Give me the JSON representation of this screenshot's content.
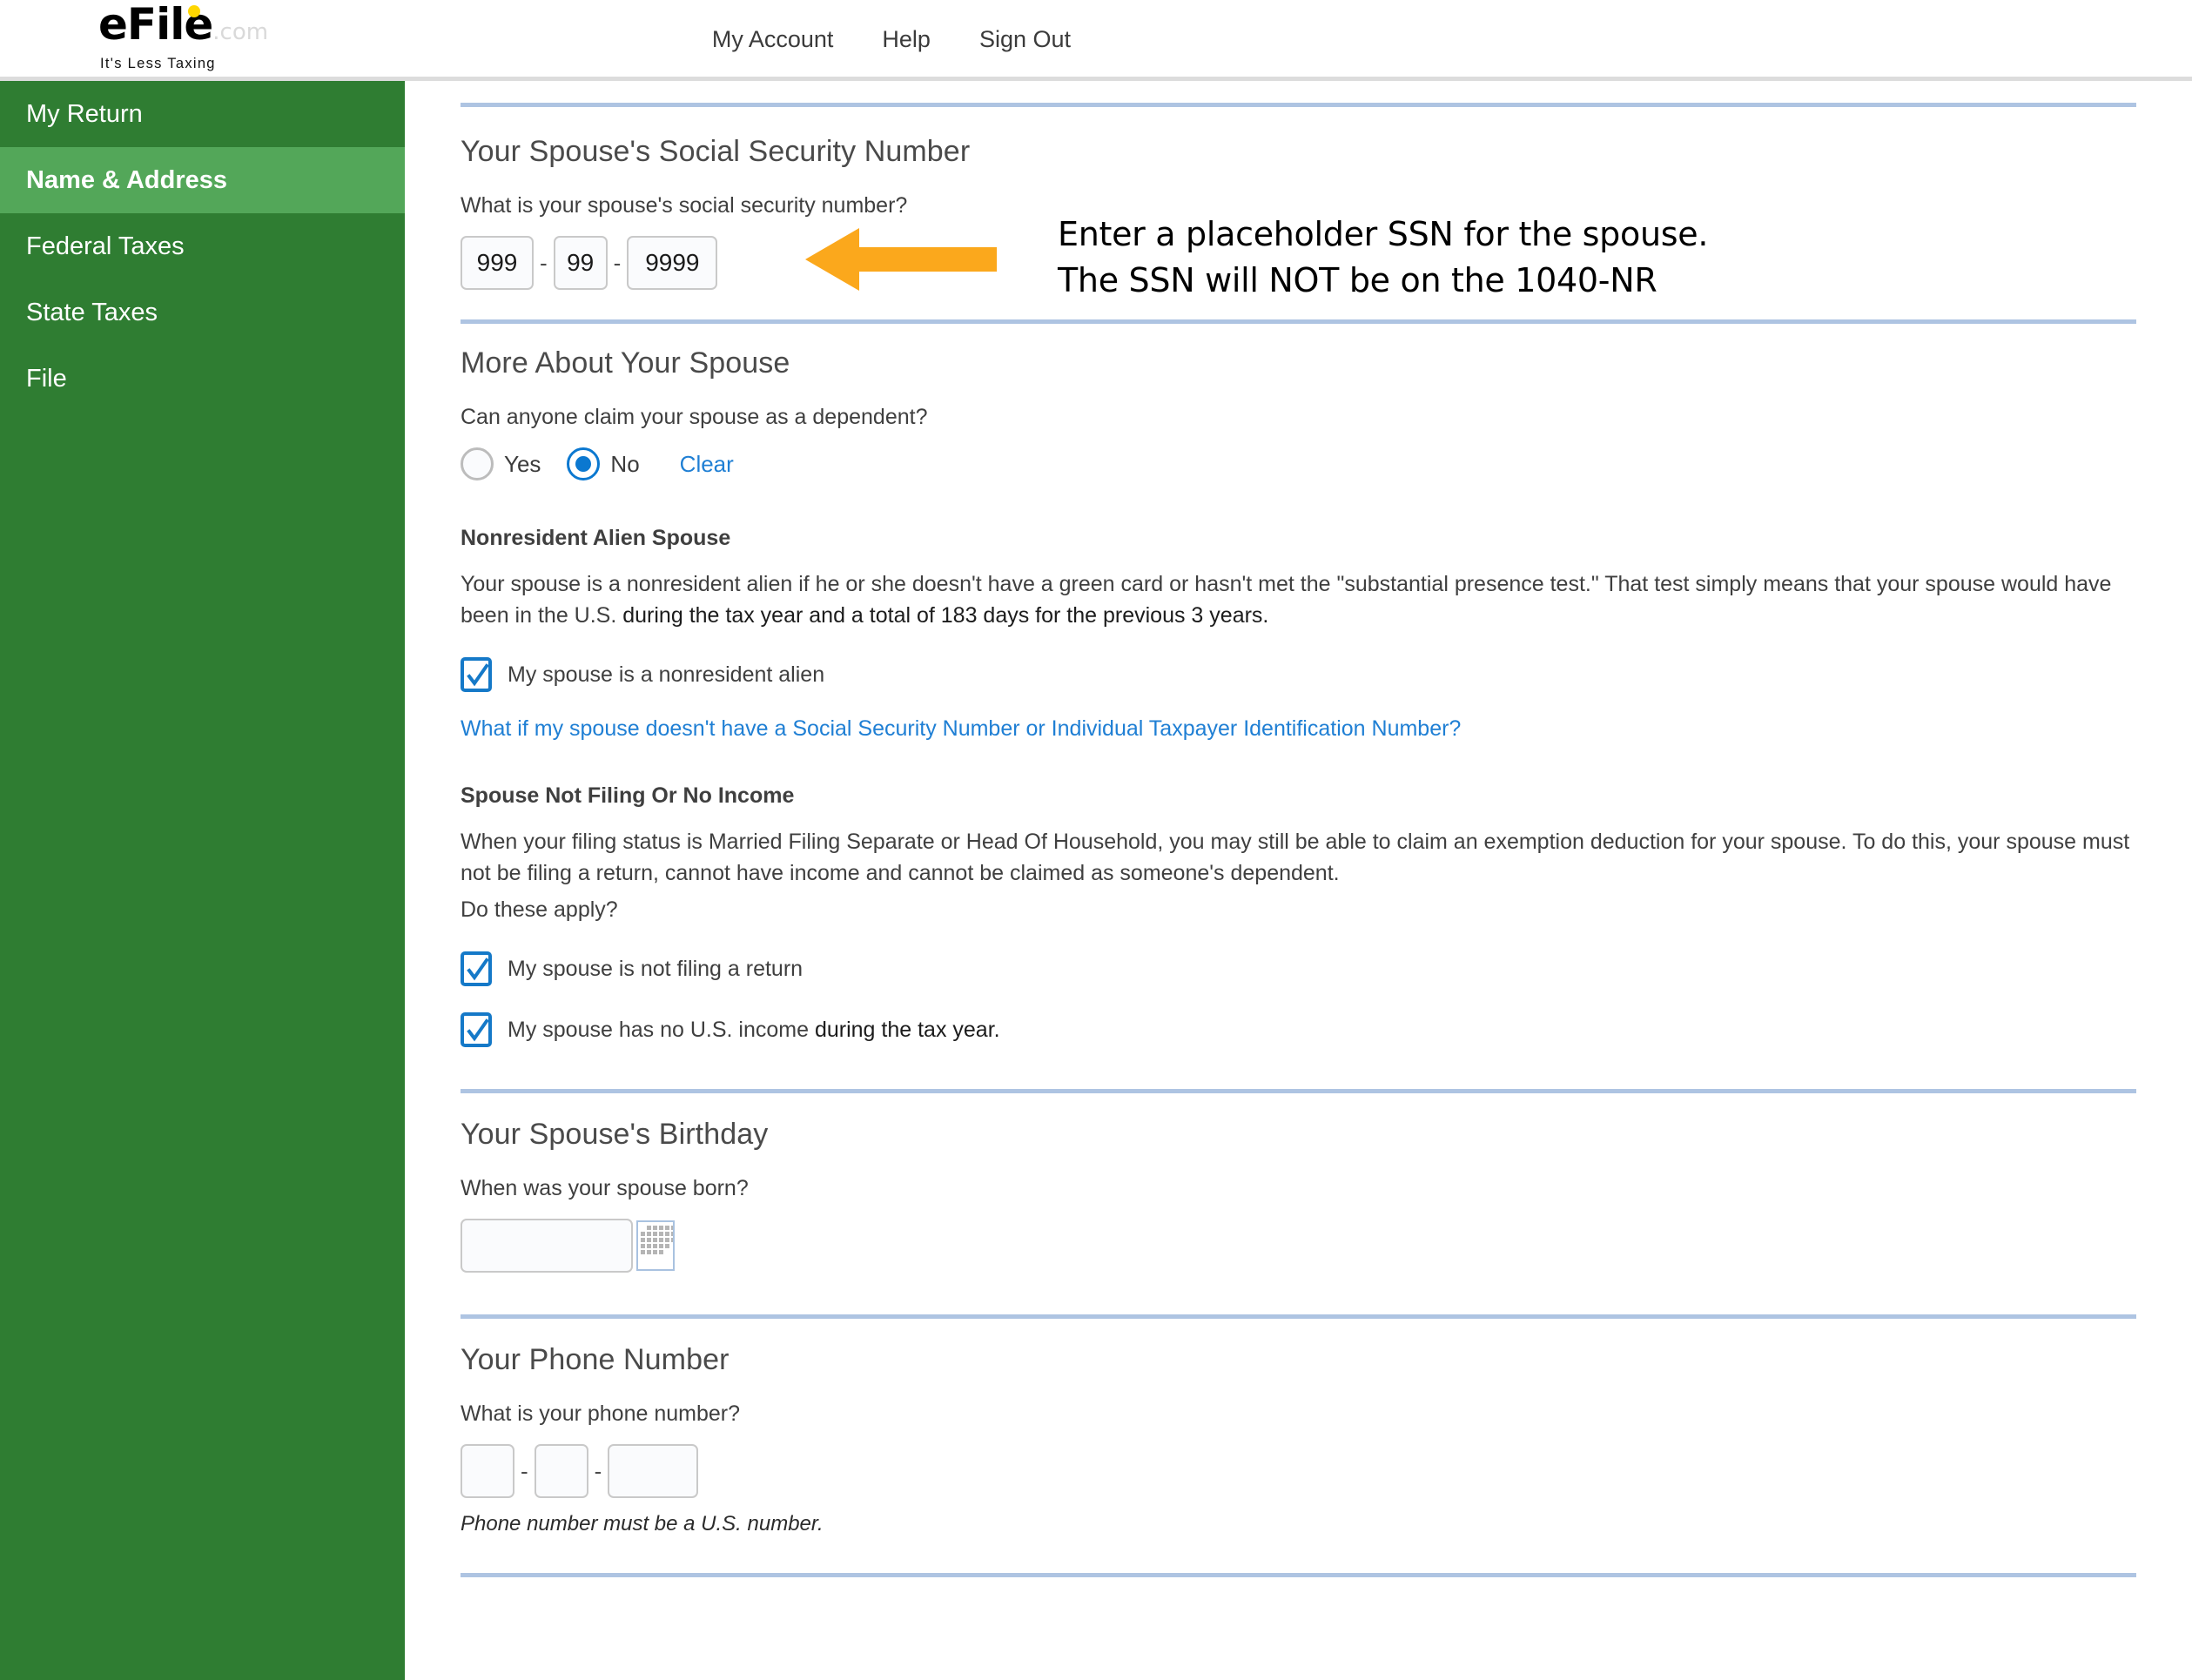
{
  "header": {
    "logo": {
      "main": "eFile",
      "dotcom": ".com",
      "tagline": "It's Less Taxing"
    },
    "nav": [
      {
        "label": "My Account",
        "name": "nav-my-account"
      },
      {
        "label": "Help",
        "name": "nav-help"
      },
      {
        "label": "Sign Out",
        "name": "nav-sign-out"
      }
    ]
  },
  "sidebar": {
    "items": [
      {
        "label": "My Return",
        "active": false
      },
      {
        "label": "Name & Address",
        "active": true
      },
      {
        "label": "Federal Taxes",
        "active": false
      },
      {
        "label": "State Taxes",
        "active": false
      },
      {
        "label": "File",
        "active": false
      }
    ]
  },
  "ssn_section": {
    "title": "Your Spouse's Social Security Number",
    "question": "What is your spouse's social security number?",
    "value_area": "999",
    "value_group": "99",
    "value_serial": "9999",
    "separator": "-"
  },
  "annotation": {
    "line1": "Enter a placeholder SSN for the spouse.",
    "line2": "The SSN will NOT be on the 1040-NR",
    "arrow_color": "#FBA81C",
    "arrow_direction": "left"
  },
  "more_about": {
    "title": "More About Your Spouse",
    "question": "Can anyone claim your spouse as a dependent?",
    "options": [
      {
        "label": "Yes",
        "selected": false
      },
      {
        "label": "No",
        "selected": true
      }
    ],
    "clear_label": "Clear"
  },
  "nonresident": {
    "heading": "Nonresident Alien Spouse",
    "paragraph_part1": "Your spouse is a nonresident alien if he or she doesn't have a green card or hasn't met the \"substantial presence test.\" That test simply means that your spouse would have been in the U.S.",
    "paragraph_part2": "during the tax year and a total of 183 days for the previous 3 years.",
    "checkbox_label": "My spouse is a nonresident alien",
    "checkbox_checked": true,
    "link": "What if my spouse doesn't have a Social Security Number or Individual Taxpayer Identification Number?"
  },
  "not_filing": {
    "heading": "Spouse Not Filing Or No Income",
    "paragraph": "When your filing status is Married Filing Separate or Head Of Household, you may still be able to claim an exemption deduction for your spouse. To do this, your spouse must not be filing a return, cannot have income and cannot be claimed as someone's dependent.",
    "question": "Do these apply?",
    "checkbox1_label": "My spouse is not filing a return",
    "checkbox1_checked": true,
    "checkbox2_label_part1": "My spouse has no U.S. income",
    "checkbox2_label_part2": "during the tax year.",
    "checkbox2_checked": true
  },
  "birthday": {
    "title": "Your Spouse's Birthday",
    "question": "When was your spouse born?",
    "value": "",
    "placeholder": "",
    "calendar_icon": "calendar-icon"
  },
  "phone": {
    "title": "Your Phone Number",
    "question": "What is your phone number?",
    "area": "",
    "prefix": "",
    "line": "",
    "separator": "-",
    "note": "Phone number must be a U.S. number."
  },
  "colors": {
    "sidebar_green": "#2F7D32",
    "sidebar_active_green": "#53A759",
    "link_blue": "#1F7FD4",
    "control_blue": "#1579C8",
    "divider_blue": "#AEC4E2",
    "accent_orange": "#FBA81C",
    "logo_dot_yellow": "#FFD700"
  }
}
